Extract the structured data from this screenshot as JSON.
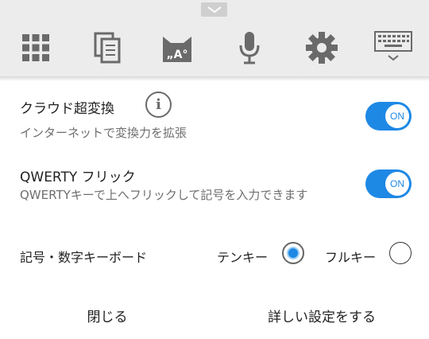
{
  "toolbar": {
    "icons": [
      "collapse-chevron-icon",
      "grid-icon",
      "copy-icon",
      "cat-face-icon",
      "microphone-icon",
      "gear-icon",
      "keyboard-icon"
    ]
  },
  "settings": {
    "cloud_conversion": {
      "title": "クラウド超変換",
      "description": "インターネットで変換力を拡張",
      "toggle": "ON"
    },
    "qwerty_flick": {
      "title": "QWERTY フリック",
      "description": "QWERTYキーで上へフリックして記号を入力できます",
      "toggle": "ON"
    },
    "symbol_keyboard": {
      "label": "記号・数字キーボード",
      "options": [
        {
          "label": "テンキー",
          "selected": true
        },
        {
          "label": "フルキー",
          "selected": false
        }
      ]
    }
  },
  "footer": {
    "close_label": "閉じる",
    "detailed_settings_label": "詳しい設定をする"
  },
  "colors": {
    "accent": "#1e88e5",
    "toolbar_bg": "#ececec",
    "icon_gray": "#6a6a6a"
  }
}
